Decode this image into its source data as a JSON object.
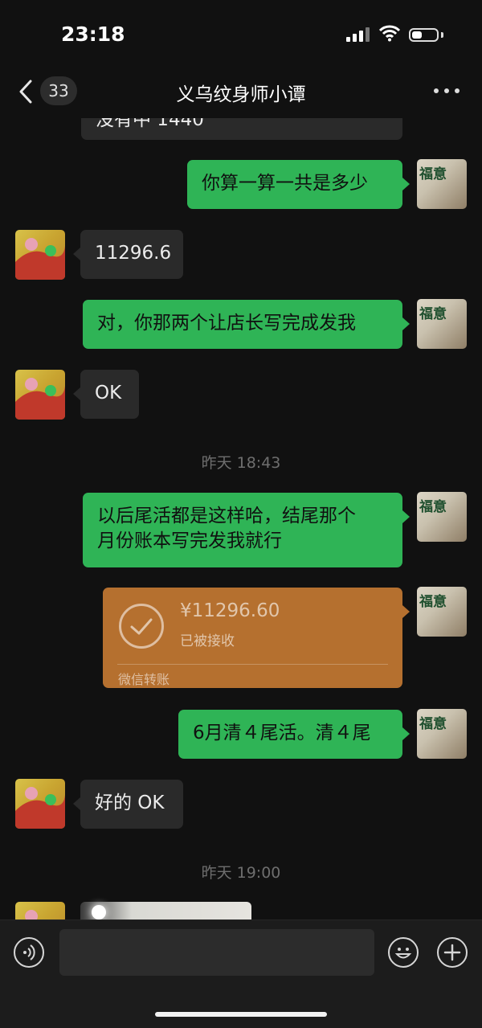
{
  "status_bar": {
    "time": "23:18",
    "battery_level": 0.35
  },
  "nav": {
    "back_icon": "chevron-left-icon",
    "unread_count": "33",
    "title": "义乌纹身师小谭",
    "more_icon": "more-horizontal-icon"
  },
  "messages": [
    {
      "type": "text",
      "from": "them",
      "text": "没有中 1440"
    },
    {
      "type": "text",
      "from": "me",
      "text": "你算一算一共是多少"
    },
    {
      "type": "text",
      "from": "them",
      "text": "11296.6"
    },
    {
      "type": "text",
      "from": "me",
      "text": "对，你那两个让店长写完成发我"
    },
    {
      "type": "text",
      "from": "them",
      "text": "OK"
    },
    {
      "type": "timestamp",
      "text": "昨天 18:43"
    },
    {
      "type": "text",
      "from": "me",
      "lines": [
        "以后尾活都是这样哈，结尾那个",
        "月份账本写完发我就行"
      ]
    },
    {
      "type": "transfer",
      "from": "me",
      "amount": "¥11296.60",
      "status": "已被接收",
      "label": "微信转账"
    },
    {
      "type": "text",
      "from": "me",
      "text": "6月清４尾活。清４尾"
    },
    {
      "type": "text",
      "from": "them",
      "text": "好的 OK"
    },
    {
      "type": "timestamp",
      "text": "昨天 19:00"
    },
    {
      "type": "image",
      "from": "them"
    }
  ],
  "avatar_me": {
    "stamp": "福意"
  },
  "input_bar": {
    "voice_icon": "voice-icon",
    "emoji_icon": "emoji-icon",
    "plus_icon": "plus-icon"
  },
  "colors": {
    "background": "#111111",
    "my_bubble": "#2fb456",
    "their_bubble": "#2a2a2a",
    "transfer": "#b5702f",
    "timestamp": "#6e6e6e"
  }
}
